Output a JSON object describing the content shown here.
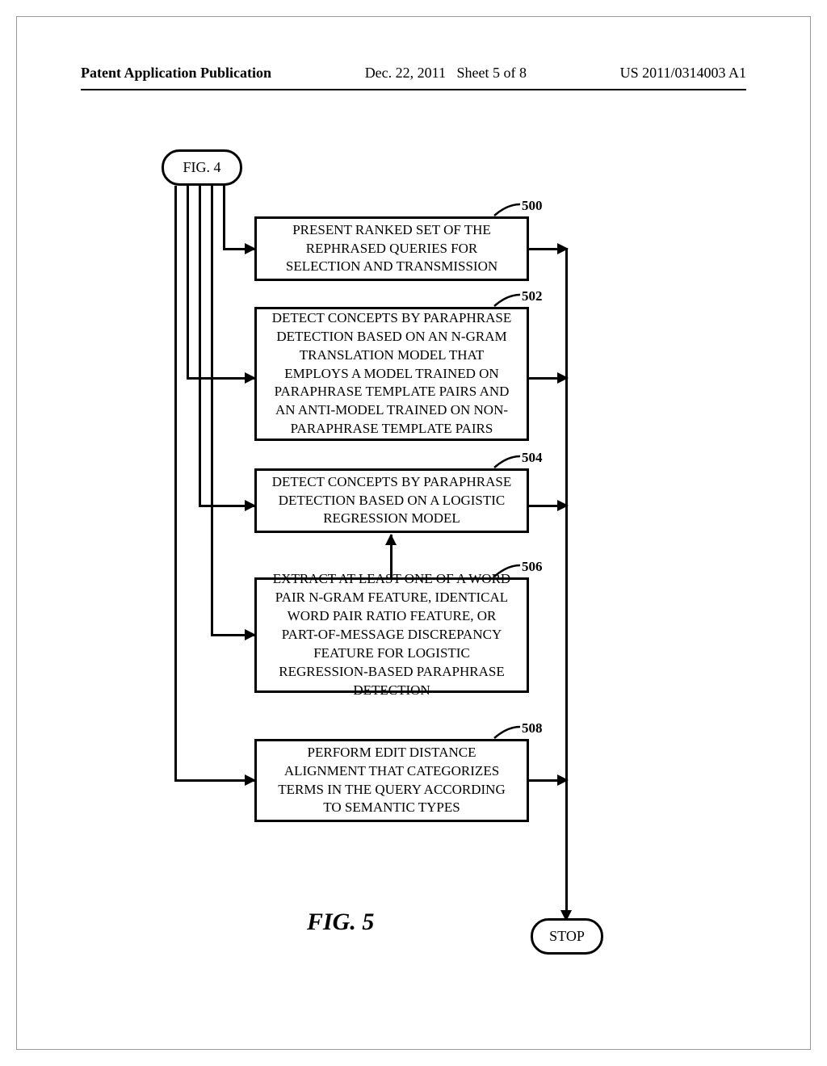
{
  "header": {
    "left": "Patent Application Publication",
    "date": "Dec. 22, 2011",
    "sheet": "Sheet 5 of 8",
    "pubnum": "US 2011/0314003 A1"
  },
  "terminals": {
    "start": "FIG. 4",
    "stop": "STOP"
  },
  "boxes": {
    "b500": "PRESENT RANKED SET OF THE REPHRASED QUERIES FOR SELECTION AND TRANSMISSION",
    "b502": "DETECT CONCEPTS BY PARAPHRASE DETECTION BASED ON AN N-GRAM TRANSLATION MODEL THAT EMPLOYS A MODEL TRAINED ON PARAPHRASE TEMPLATE PAIRS AND AN ANTI-MODEL TRAINED ON NON-PARAPHRASE TEMPLATE PAIRS",
    "b504": "DETECT CONCEPTS BY PARAPHRASE DETECTION BASED ON A LOGISTIC REGRESSION MODEL",
    "b506": "EXTRACT AT LEAST ONE OF A WORD PAIR N-GRAM FEATURE, IDENTICAL WORD PAIR RATIO FEATURE, OR PART-OF-MESSAGE DISCREPANCY FEATURE FOR LOGISTIC REGRESSION-BASED PARAPHRASE DETECTION",
    "b508": "PERFORM EDIT DISTANCE ALIGNMENT THAT CATEGORIZES TERMS IN THE QUERY ACCORDING TO SEMANTIC TYPES"
  },
  "refs": {
    "r500": "500",
    "r502": "502",
    "r504": "504",
    "r506": "506",
    "r508": "508"
  },
  "figure_label": "FIG. 5",
  "chart_data": {
    "type": "flowchart",
    "start": {
      "id": "start",
      "label": "FIG. 4",
      "shape": "terminal"
    },
    "end": {
      "id": "stop",
      "label": "STOP",
      "shape": "terminal"
    },
    "nodes": [
      {
        "id": "500",
        "label": "PRESENT RANKED SET OF THE REPHRASED QUERIES FOR SELECTION AND TRANSMISSION",
        "shape": "process"
      },
      {
        "id": "502",
        "label": "DETECT CONCEPTS BY PARAPHRASE DETECTION BASED ON AN N-GRAM TRANSLATION MODEL THAT EMPLOYS A MODEL TRAINED ON PARAPHRASE TEMPLATE PAIRS AND AN ANTI-MODEL TRAINED ON NON-PARAPHRASE TEMPLATE PAIRS",
        "shape": "process"
      },
      {
        "id": "504",
        "label": "DETECT CONCEPTS BY PARAPHRASE DETECTION BASED ON A LOGISTIC REGRESSION MODEL",
        "shape": "process"
      },
      {
        "id": "506",
        "label": "EXTRACT AT LEAST ONE OF A WORD PAIR N-GRAM FEATURE, IDENTICAL WORD PAIR RATIO FEATURE, OR PART-OF-MESSAGE DISCREPANCY FEATURE FOR LOGISTIC REGRESSION-BASED PARAPHRASE DETECTION",
        "shape": "process"
      },
      {
        "id": "508",
        "label": "PERFORM EDIT DISTANCE ALIGNMENT THAT CATEGORIZES TERMS IN THE QUERY ACCORDING TO SEMANTIC TYPES",
        "shape": "process"
      }
    ],
    "edges": [
      {
        "from": "start",
        "to": "500"
      },
      {
        "from": "start",
        "to": "502"
      },
      {
        "from": "start",
        "to": "504"
      },
      {
        "from": "start",
        "to": "506"
      },
      {
        "from": "start",
        "to": "508"
      },
      {
        "from": "506",
        "to": "504"
      },
      {
        "from": "500",
        "to": "stop"
      },
      {
        "from": "502",
        "to": "stop"
      },
      {
        "from": "504",
        "to": "stop"
      },
      {
        "from": "508",
        "to": "stop"
      }
    ]
  }
}
